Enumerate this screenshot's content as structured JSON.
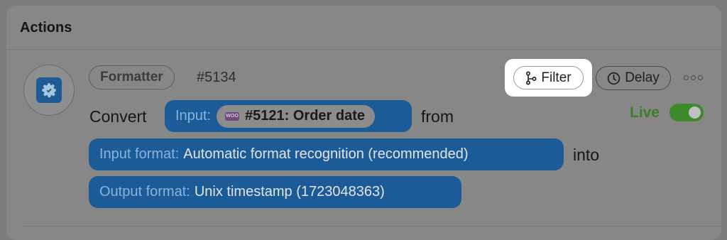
{
  "section": {
    "title": "Actions"
  },
  "step": {
    "icon": "formatter-gear-icon",
    "app_tag": "Formatter",
    "number": "#5134",
    "filter_label": "Filter",
    "delay_label": "Delay",
    "status_label": "Live",
    "status_on": true
  },
  "sentence": {
    "convert": "Convert",
    "from": "from",
    "into": "into",
    "input_label": "Input:",
    "input_source_badge": "WOO",
    "input_value": "#5121: Order date",
    "input_format_label": "Input format:",
    "input_format_value": "Automatic format recognition (recommended)",
    "output_format_label": "Output format:",
    "output_format_value": "Unix timestamp (1723048363)"
  },
  "colors": {
    "accent": "#1b5c98",
    "live_green": "#3d8a2c"
  }
}
